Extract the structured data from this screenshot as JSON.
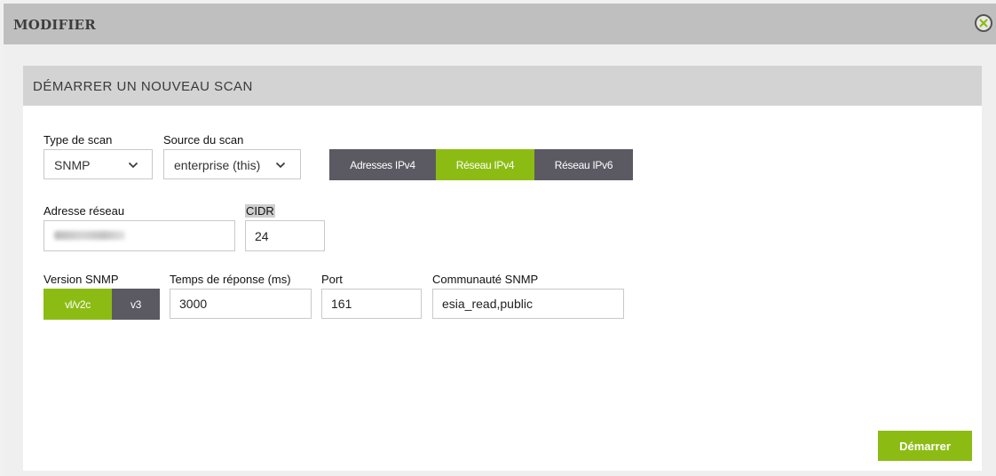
{
  "modal": {
    "title": "MODIFIER"
  },
  "panel": {
    "title": "DÉMARRER UN NOUVEAU SCAN"
  },
  "scan_type": {
    "label": "Type de scan",
    "value": "SNMP"
  },
  "scan_source": {
    "label": "Source du scan",
    "value": "enterprise (this)"
  },
  "address_mode": {
    "options": [
      "Adresses IPv4",
      "Réseau IPv4",
      "Réseau IPv6"
    ],
    "selected": "Réseau IPv4"
  },
  "network_address": {
    "label": "Adresse réseau",
    "value": ""
  },
  "cidr": {
    "label": "CIDR",
    "value": "24"
  },
  "snmp_version": {
    "label": "Version SNMP",
    "options": [
      "vl/v2c",
      "v3"
    ],
    "selected": "vl/v2c"
  },
  "response_time": {
    "label": "Temps de réponse (ms)",
    "value": "3000"
  },
  "port": {
    "label": "Port",
    "value": "161"
  },
  "community": {
    "label": "Communauté SNMP",
    "value": "esia_read,public"
  },
  "actions": {
    "start_label": "Démarrer"
  },
  "colors": {
    "accent_green": "#8cbc14",
    "segment_dark": "#5b5a63",
    "header_gray": "#c0bfbf"
  },
  "icons": {
    "close": "close-icon",
    "dropdown": "chevron-down-icon"
  }
}
